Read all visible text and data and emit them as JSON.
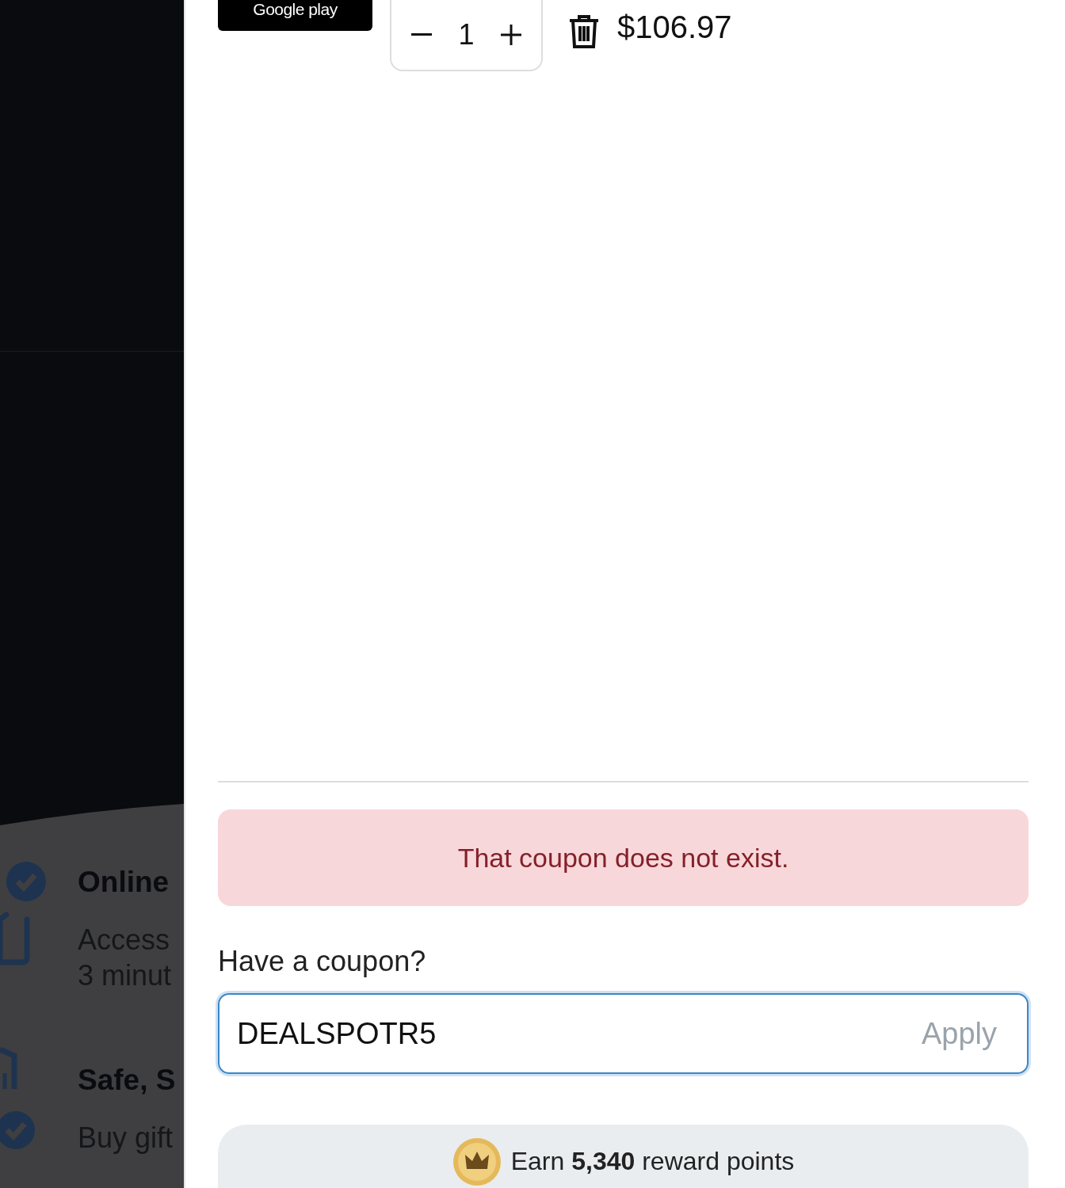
{
  "backdrop": {
    "features": [
      {
        "title": "Online",
        "lines": [
          "Access",
          "3 minut"
        ]
      },
      {
        "title": "Safe, S",
        "lines": [
          "Buy gift"
        ]
      }
    ]
  },
  "cart": {
    "items": [
      {
        "badge": "Google play",
        "quantity": "1",
        "price": "$106.97"
      }
    ],
    "alert": "That coupon does not exist.",
    "coupon": {
      "label": "Have a coupon?",
      "value": "DEALSPOTR5",
      "button": "Apply"
    },
    "rewards": "Earn **5,340** reward points"
  }
}
